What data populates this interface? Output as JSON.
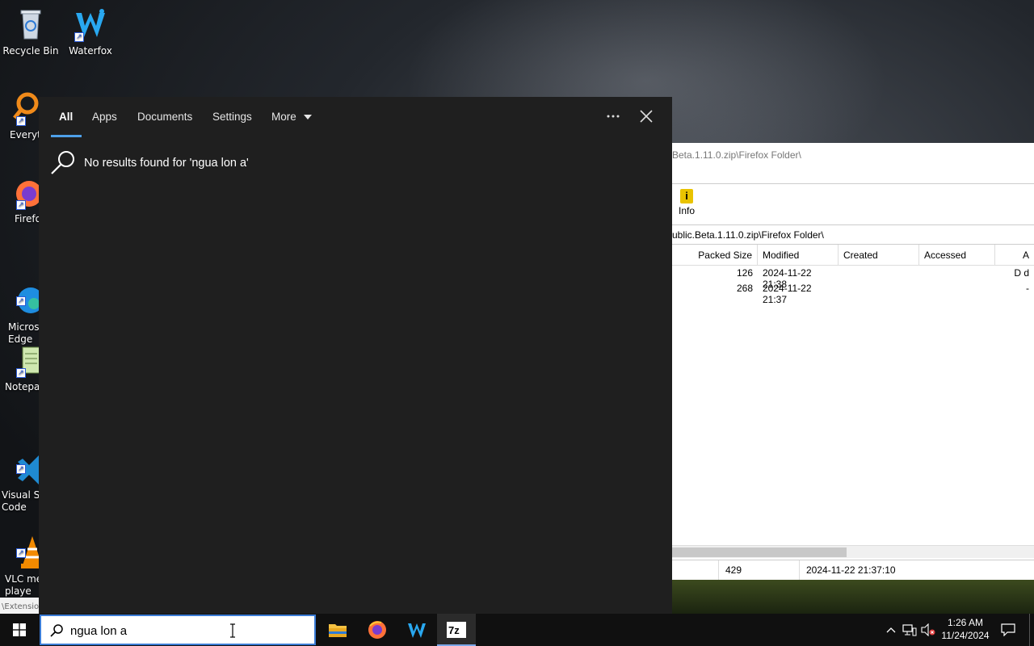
{
  "desktop": {
    "icons": [
      {
        "label": "Recycle Bin",
        "icon": "recycle-bin-icon"
      },
      {
        "label": "Waterfox",
        "icon": "waterfox-icon"
      },
      {
        "label": "Everyth",
        "icon": "everything-icon"
      },
      {
        "label": "Firefo",
        "icon": "firefox-icon"
      },
      {
        "label": "Micros\nEdge",
        "icon": "edge-icon"
      },
      {
        "label": "Notepac",
        "icon": "notepad-icon"
      },
      {
        "label": "Visual St\nCode",
        "icon": "vscode-icon"
      },
      {
        "label": "VLC me\nplaye",
        "icon": "vlc-icon"
      }
    ],
    "sliver_text": "\\Extensio"
  },
  "zip_window": {
    "title_path": "Beta.1.11.0.zip\\Firefox Folder\\",
    "info_label": "Info",
    "address_path": "ublic.Beta.1.11.0.zip\\Firefox Folder\\",
    "columns": [
      "Packed Size",
      "Modified",
      "Created",
      "Accessed",
      "A"
    ],
    "rows": [
      {
        "packed": "126",
        "modified": "2024-11-22 21:38",
        "attr": "D d"
      },
      {
        "packed": "268",
        "modified": "2024-11-22 21:37",
        "attr": "-"
      }
    ],
    "status": {
      "size": "429",
      "date": "2024-11-22 21:37:10"
    }
  },
  "search_panel": {
    "tabs": [
      "All",
      "Apps",
      "Documents",
      "Settings",
      "More"
    ],
    "no_results": "No results found for 'ngua lon a'",
    "accent": "#4ea0e8"
  },
  "taskbar": {
    "search_value": "ngua lon a",
    "time": "1:26 AM",
    "date": "11/24/2024",
    "apps": [
      "file-explorer-icon",
      "firefox-icon",
      "waterfox-icon",
      "7zip-icon"
    ]
  }
}
